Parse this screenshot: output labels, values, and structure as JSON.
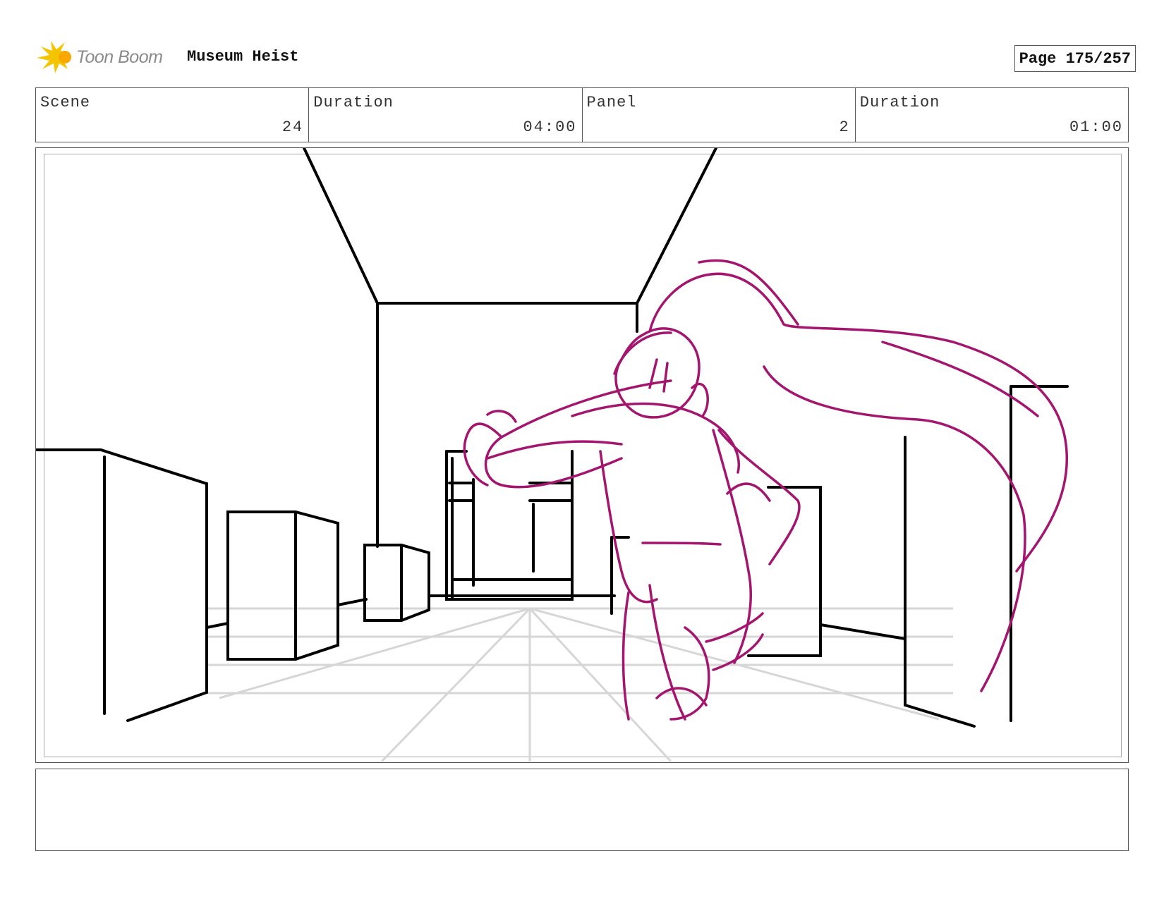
{
  "header": {
    "logo_text": "Toon Boom",
    "project_title": "Museum Heist",
    "page_label": "Page 175/257"
  },
  "info": [
    {
      "label": "Scene",
      "value": "24"
    },
    {
      "label": "Duration",
      "value": "04:00"
    },
    {
      "label": "Panel",
      "value": "2"
    },
    {
      "label": "Duration",
      "value": "01:00"
    }
  ],
  "colors": {
    "sketch_line": "#000000",
    "character_line": "#a3156e",
    "grid_line": "#d6d6d6",
    "logo_star": "#f5c400"
  },
  "notes": {
    "text": ""
  }
}
